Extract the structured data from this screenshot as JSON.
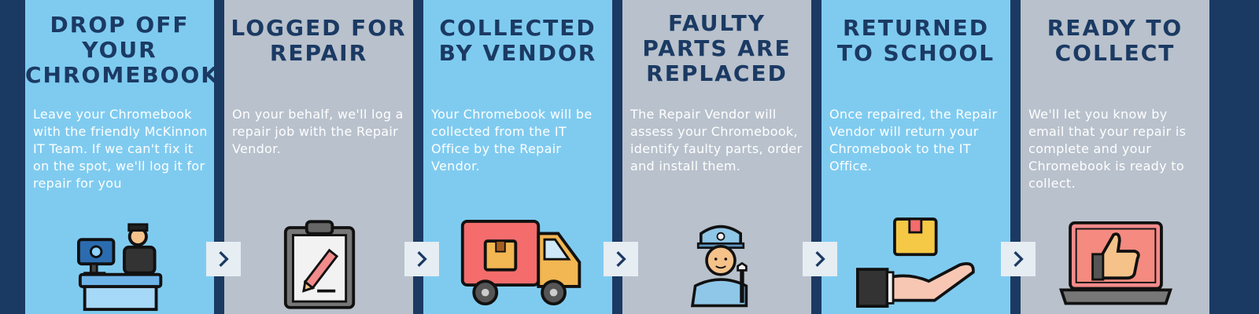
{
  "steps": [
    {
      "title": "Drop off your Chromebook",
      "description": "Leave your Chromebook with the friendly McKinnon IT Team. If we can't fix it on the spot, we'll log it for repair for you",
      "icon": "desk-reception-icon"
    },
    {
      "title": "Logged for repair",
      "description": "On your behalf, we'll log a repair job with the Repair Vendor.",
      "icon": "clipboard-pencil-icon"
    },
    {
      "title": "Collected by vendor",
      "description": "Your Chromebook will be collected from the IT Office by the Repair Vendor.",
      "icon": "delivery-truck-icon"
    },
    {
      "title": "Faulty parts are replaced",
      "description": "The Repair Vendor will assess your Chromebook, identify faulty parts, order and install them.",
      "icon": "technician-wrench-icon"
    },
    {
      "title": "Returned to school",
      "description": "Once repaired, the Repair Vendor will return your Chromebook to the IT Office.",
      "icon": "hand-package-icon"
    },
    {
      "title": "Ready to collect",
      "description": "We'll let you know by email that your repair is complete and your Chromebook is ready to collect.",
      "icon": "laptop-thumbs-up-icon"
    }
  ],
  "colors": {
    "navy": "#1b3a63",
    "blue_panel": "#7fcbf0",
    "grey_panel": "#b8c1cc",
    "arrow_bg": "#e6edf3"
  }
}
